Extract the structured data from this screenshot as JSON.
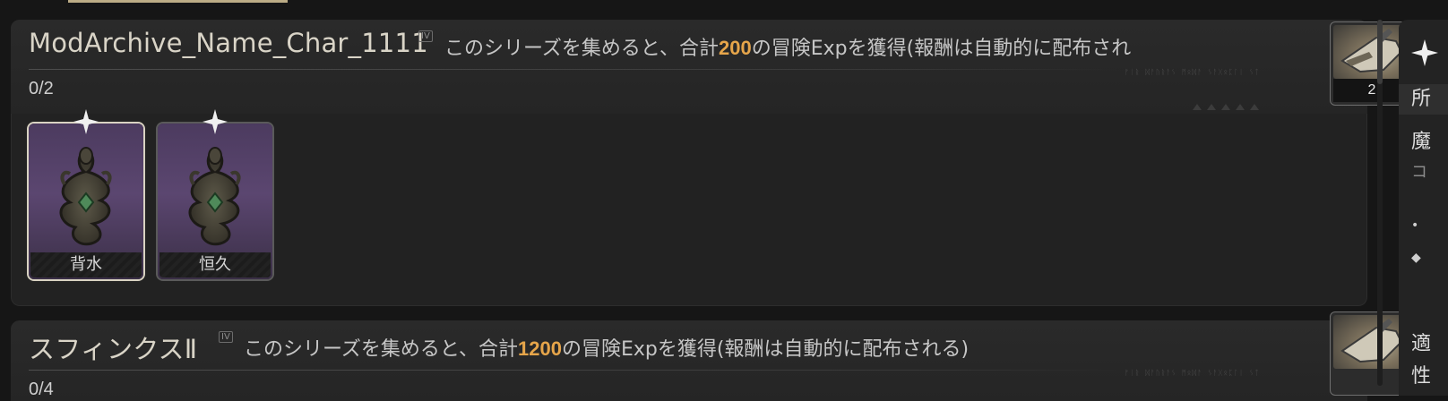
{
  "series": [
    {
      "title": "ModArchive_Name_Char_1111",
      "roman": "IV",
      "desc_before": "このシリーズを集めると、合計",
      "amount": "200",
      "desc_after": "の冒険Expを獲得(報酬は自動的に配布され",
      "progress": "0/2",
      "reward_count": "2",
      "cards": [
        {
          "name": "背水"
        },
        {
          "name": "恒久"
        }
      ]
    },
    {
      "title": "スフィンクスⅡ",
      "roman": "IV",
      "desc_before": "このシリーズを集めると、合計",
      "amount": "1200",
      "desc_after": "の冒険Expを獲得(報酬は自動的に配布される)",
      "progress": "0/4"
    }
  ],
  "side_panel": {
    "row1": "所",
    "row2": "魔",
    "row3": "コ",
    "row7": "適",
    "row8": "性"
  },
  "colors": {
    "accent_amount": "#e6a54a",
    "card_bg": "#5b4670",
    "panel_bg": "#222222"
  }
}
